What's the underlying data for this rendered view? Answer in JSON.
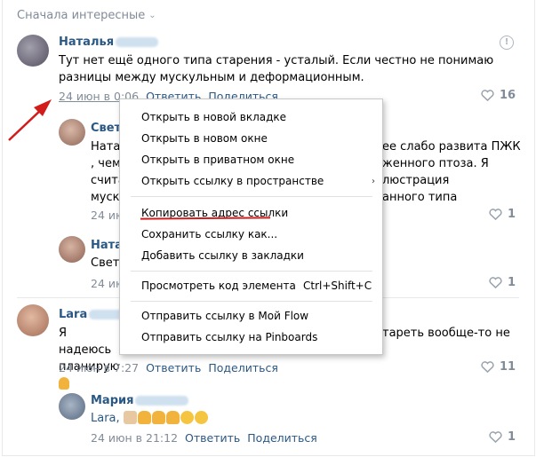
{
  "sort_label": "Сначала интересные",
  "colors": {
    "link": "#2a5885",
    "muted": "#818c99",
    "red": "#d21c1c"
  },
  "comments": [
    {
      "author": "Наталья",
      "text_lines": [
        "Тут нет ещё одного типа старения - усталый. Если честно не понимаю",
        "разницы между мускульным и деформационным."
      ],
      "date": "24 июн в 0:06",
      "reply": "Ответить",
      "share": "Поделиться",
      "likes": "16"
    },
    {
      "author": "Светл",
      "text_lines": [
        "Ната",
        "ее слабо развита ПЖК",
        ", чем",
        "женного птоза. Я",
        "счита",
        "люстрация",
        "муск",
        "анного типа"
      ],
      "date": "24 ию",
      "likes": "1"
    },
    {
      "author": "Ната",
      "text_lines": [
        "Светл"
      ],
      "date": "24 ию",
      "likes": "1"
    },
    {
      "author": "Lara",
      "text_lines": [
        "Я надеюсь",
        "тареть вообще-то не",
        "планирую"
      ],
      "date": "24 июн в 7:27",
      "reply": "Ответить",
      "share": "Поделиться",
      "likes": "11"
    },
    {
      "author": "Мария",
      "text_lines": [
        "Lara,"
      ],
      "date": "24 июн в 21:12",
      "reply": "Ответить",
      "share": "Поделиться",
      "likes": "1"
    }
  ],
  "context_menu": {
    "items": [
      "Открыть в новой вкладке",
      "Открыть в новом окне",
      "Открыть в приватном окне",
      "Открыть ссылку в пространстве",
      "Копировать адрес ссылки",
      "Сохранить ссылку как...",
      "Добавить ссылку в закладки",
      "Просмотреть код элемента",
      "Отправить ссылку в Мой Flow",
      "Отправить ссылку на Pinboards"
    ],
    "inspect_shortcut": "Ctrl+Shift+C",
    "submenu_arrow": "›"
  },
  "icons": {
    "info": "!",
    "heart": "heart-icon",
    "chevron": "chevron-down-icon"
  }
}
